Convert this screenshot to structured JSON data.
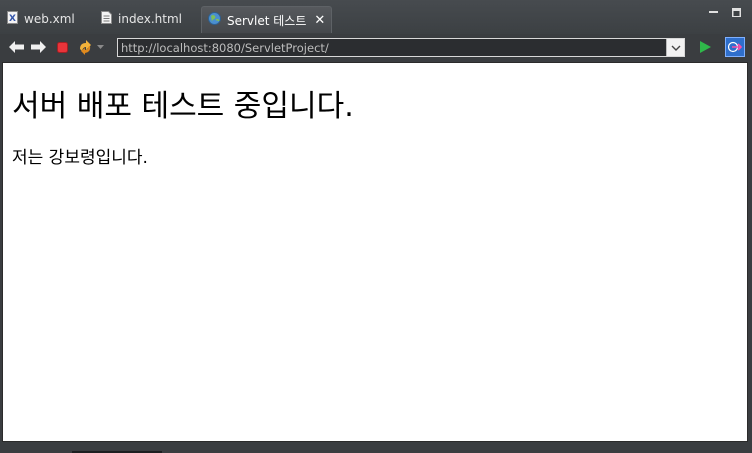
{
  "tabs": [
    {
      "label": "web.xml",
      "icon": "xml-file-icon"
    },
    {
      "label": "index.html",
      "icon": "html-file-icon"
    },
    {
      "label": "Servlet 테스트",
      "icon": "globe-icon",
      "active": true
    }
  ],
  "toolbar": {
    "back": "back-arrow-icon",
    "forward": "forward-arrow-icon",
    "stop": "stop-icon",
    "refresh": "refresh-icon",
    "go": "go-icon",
    "open_external": "external-browser-icon"
  },
  "address_bar": {
    "url": "http://localhost:8080/ServletProject/"
  },
  "page": {
    "heading": "서버 배포 테스트 중입니다.",
    "paragraph": "저는 강보령입니다."
  },
  "colors": {
    "chrome_bg": "#3a3d40",
    "stop_red": "#e8343a",
    "go_green": "#2fb84a",
    "external_blue": "#2f6fcc"
  }
}
